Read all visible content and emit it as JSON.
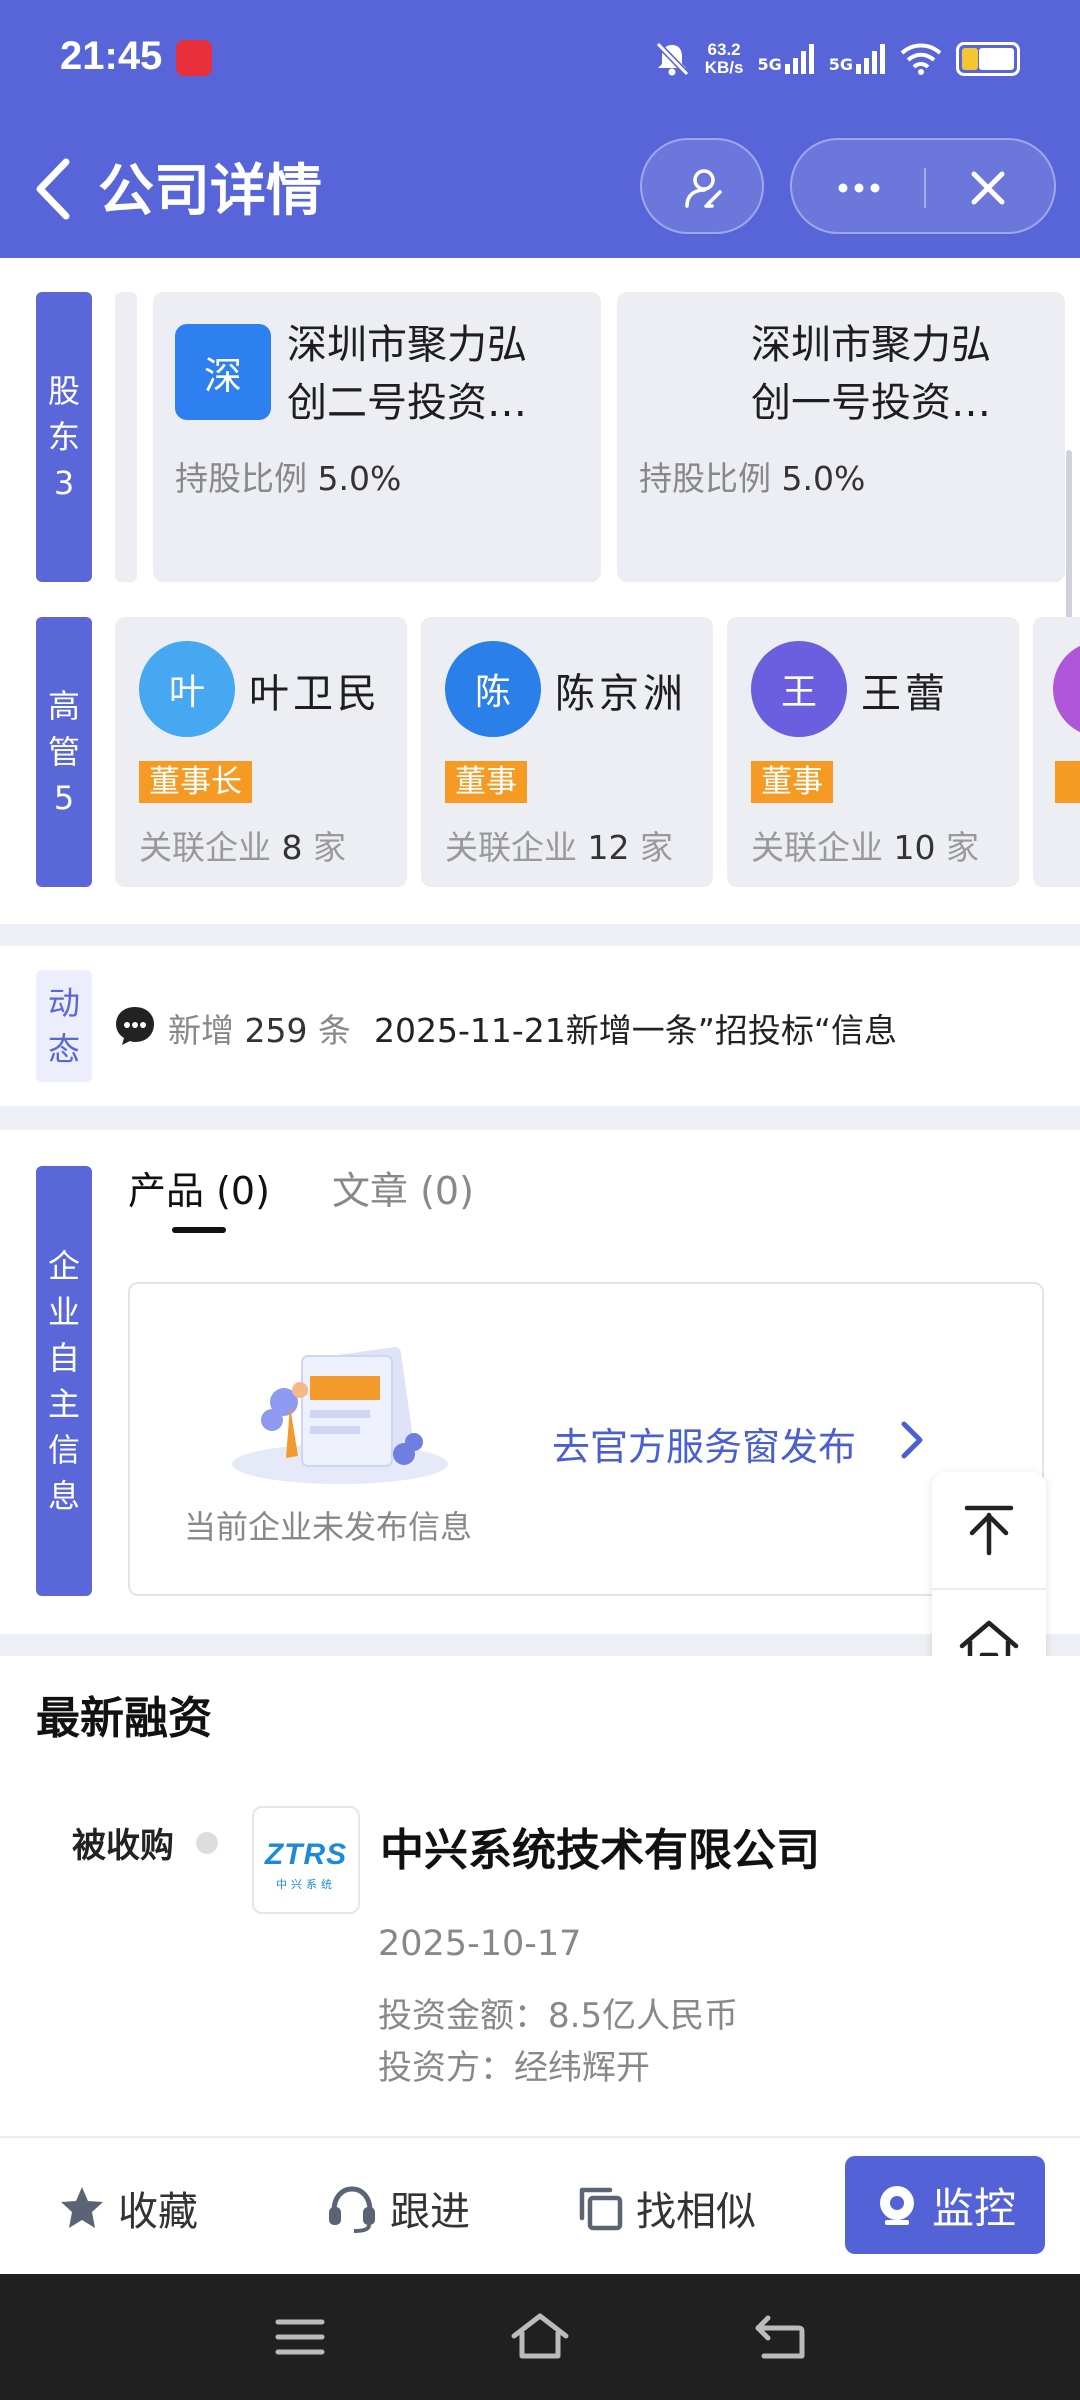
{
  "status_bar": {
    "time": "21:45",
    "net_speed_value": "63.2",
    "net_speed_unit": "KB/s",
    "signal_1": "5G",
    "signal_2": "5G"
  },
  "nav": {
    "title": "公司详情"
  },
  "shareholders": {
    "tag_chars": [
      "股",
      "东",
      "3"
    ],
    "ratio_label": "持股比例",
    "items": [
      {
        "logo_char": "深",
        "name": "深圳市聚力弘创二号投资…",
        "name_line1": "深圳市聚力弘",
        "name_line2": "创二号投资…",
        "ratio": "5.0%"
      },
      {
        "name_line1": "深圳市聚力弘",
        "name_line2": "创一号投资…",
        "ratio": "5.0%"
      }
    ]
  },
  "executives": {
    "tag_chars": [
      "高",
      "管",
      "5"
    ],
    "related_prefix": "关联企业",
    "related_suffix": "家",
    "items": [
      {
        "avatar_char": "叶",
        "name": "叶卫民",
        "role": "董事长",
        "related_count": "8",
        "avatar_color": "#45a8f0"
      },
      {
        "avatar_char": "陈",
        "name": "陈京洲",
        "role": "董事",
        "related_count": "12",
        "avatar_color": "#2a7fe8"
      },
      {
        "avatar_char": "王",
        "name": "王蕾",
        "role": "董事",
        "related_count": "10",
        "avatar_color": "#6b5fe0"
      }
    ]
  },
  "dynamics": {
    "tag_chars": [
      "动",
      "态"
    ],
    "new_prefix": "新增",
    "new_count": "259",
    "new_suffix": "条",
    "latest": "2025-11-21新增一条”招投标“信息"
  },
  "self_info": {
    "tag_chars": [
      "企",
      "业",
      "自",
      "主",
      "信",
      "息"
    ],
    "tabs": [
      {
        "label": "产品 (0)",
        "active": true
      },
      {
        "label": "文章 (0)",
        "active": false
      }
    ],
    "empty_text": "当前企业未发布信息",
    "publish_link": "去官方服务窗发布"
  },
  "financing": {
    "title": "最新融资",
    "type": "被收购",
    "logo_text": "ZTRS",
    "logo_subtext": "中兴系统",
    "company": "中兴系统技术有限公司",
    "date": "2025-10-17",
    "amount": "投资金额：8.5亿人民币",
    "investor": "投资方：经纬辉开"
  },
  "actions": {
    "favorite": "收藏",
    "follow_up": "跟进",
    "find_similar": "找相似",
    "monitor": "监控"
  },
  "colors": {
    "brand": "#5865d8",
    "role_badge": "#f59a23",
    "link": "#4a5fd0"
  }
}
